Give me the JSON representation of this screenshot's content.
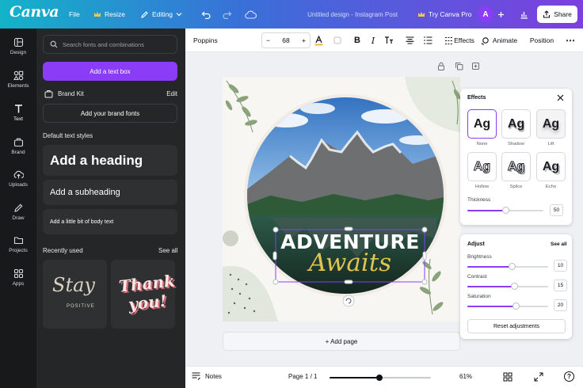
{
  "header": {
    "logo": "Canva",
    "file_label": "File",
    "resize_label": "Resize",
    "editing_label": "Editing",
    "doc_title": "Untitled design - Instagram Post",
    "try_pro_label": "Try Canva Pro",
    "avatar_initial": "A",
    "share_label": "Share"
  },
  "rail": {
    "items": [
      {
        "label": "Design",
        "icon": "design-icon"
      },
      {
        "label": "Elements",
        "icon": "elements-icon"
      },
      {
        "label": "Text",
        "icon": "text-icon"
      },
      {
        "label": "Brand",
        "icon": "brand-icon"
      },
      {
        "label": "Uploads",
        "icon": "uploads-icon"
      },
      {
        "label": "Draw",
        "icon": "draw-icon"
      },
      {
        "label": "Projects",
        "icon": "projects-icon"
      },
      {
        "label": "Apps",
        "icon": "apps-icon"
      }
    ]
  },
  "panel": {
    "search_placeholder": "Search fonts and combinations",
    "add_text_box": "Add a text box",
    "brand_kit": "Brand Kit",
    "brand_edit": "Edit",
    "add_brand_fonts": "Add your brand fonts",
    "default_styles_title": "Default text styles",
    "heading": "Add a heading",
    "subheading": "Add a subheading",
    "body": "Add a little bit of body text",
    "recently_used": "Recently used",
    "see_all": "See all",
    "recent_cards": [
      {
        "line1": "Stay",
        "line2": "POSITIVE"
      },
      {
        "line1": "Thank",
        "line2": "you!"
      }
    ]
  },
  "toolbar": {
    "font": "Poppins",
    "font_size": "68",
    "effects_label": "Effects",
    "animate_label": "Animate",
    "position_label": "Position"
  },
  "canvas": {
    "title_line1": "ADVENTURE",
    "title_line2": "Awaits"
  },
  "add_page_label": "+ Add page",
  "effects_panel": {
    "title": "Effects",
    "styles": [
      {
        "label": "None",
        "sample": "Ag",
        "selected": true
      },
      {
        "label": "Shadow",
        "sample": "Ag",
        "selected": false
      },
      {
        "label": "Lift",
        "sample": "Ag",
        "selected": false
      },
      {
        "label": "Hollow",
        "sample": "Ag",
        "selected": false
      },
      {
        "label": "Splice",
        "sample": "Ag",
        "selected": false
      },
      {
        "label": "Echo",
        "sample": "Ag",
        "selected": false
      }
    ],
    "thickness_label": "Thickness",
    "thickness_value": "50",
    "thickness_fraction": 0.5
  },
  "adjust_panel": {
    "title": "Adjust",
    "see_all": "See all",
    "sliders": [
      {
        "label": "Brightness",
        "value": "10",
        "fraction": 0.55
      },
      {
        "label": "Contrast",
        "value": "15",
        "fraction": 0.58
      },
      {
        "label": "Saturation",
        "value": "20",
        "fraction": 0.6
      }
    ],
    "reset_label": "Reset adjustments"
  },
  "bottombar": {
    "notes_label": "Notes",
    "page_label": "Page 1 / 1",
    "zoom_label": "61%",
    "zoom_fraction": 0.49
  },
  "colors": {
    "accent": "#8b3cf7",
    "header_gradient_start": "#13b3c9",
    "header_gradient_end": "#7d3fe0",
    "panel_bg": "#252627",
    "rail_bg": "#18191b",
    "adventure_text": "#ffffff",
    "awaits_text": "#e2c34f"
  }
}
